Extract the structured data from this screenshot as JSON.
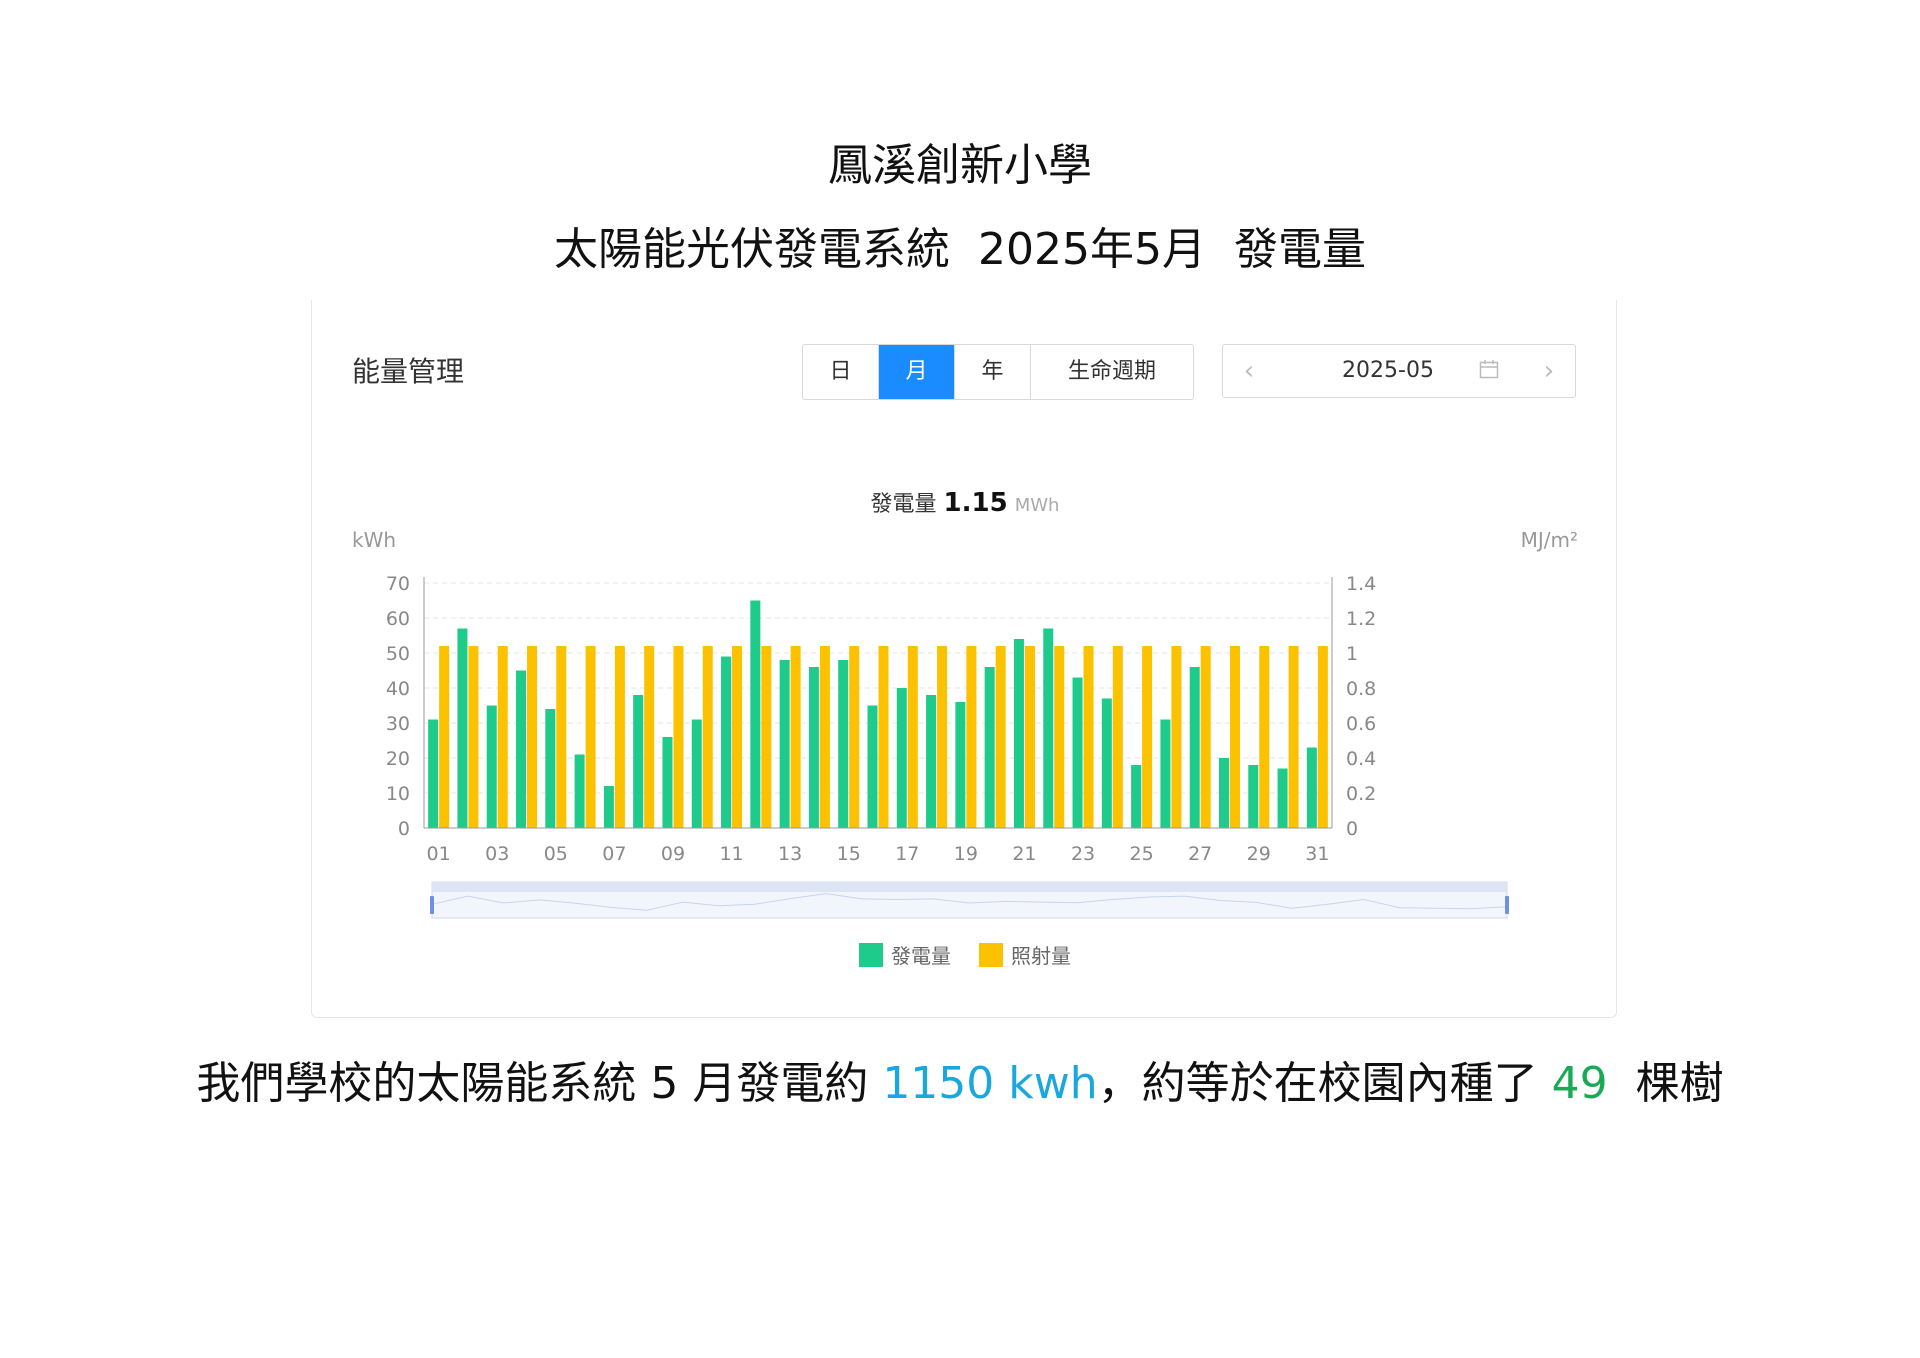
{
  "header": {
    "title": "鳳溪創新小學",
    "subtitle": "太陽能光伏發電系統  2025年5月  發電量"
  },
  "panel": {
    "title": "能量管理",
    "tabs": [
      {
        "label": "日",
        "active": false
      },
      {
        "label": "月",
        "active": true
      },
      {
        "label": "年",
        "active": false
      },
      {
        "label": "生命週期",
        "active": false
      }
    ],
    "date": "2025-05",
    "prev_icon": "‹",
    "next_icon": "›"
  },
  "summary": {
    "label": "發電量",
    "value": "1.15",
    "unit": "MWh"
  },
  "chart_data": {
    "type": "bar",
    "left_axis_unit": "kWh",
    "right_axis_unit": "MJ/m²",
    "ylim_left": [
      0,
      70
    ],
    "ylim_right": [
      0,
      1.4
    ],
    "left_ticks": [
      "0",
      "10",
      "20",
      "30",
      "40",
      "50",
      "60",
      "70"
    ],
    "right_ticks": [
      "0",
      "0.2",
      "0.4",
      "0.6",
      "0.8",
      "1",
      "1.2",
      "1.4"
    ],
    "categories": [
      "01",
      "02",
      "03",
      "04",
      "05",
      "06",
      "07",
      "08",
      "09",
      "10",
      "11",
      "12",
      "13",
      "14",
      "15",
      "16",
      "17",
      "18",
      "19",
      "20",
      "21",
      "22",
      "23",
      "24",
      "25",
      "26",
      "27",
      "28",
      "29",
      "30",
      "31"
    ],
    "x_tick_labels": [
      "01",
      "03",
      "05",
      "07",
      "09",
      "11",
      "13",
      "15",
      "17",
      "19",
      "21",
      "23",
      "25",
      "27",
      "29",
      "31"
    ],
    "grid": true,
    "legend_position": "bottom",
    "series": [
      {
        "name": "發電量",
        "axis": "left",
        "color": "#1fcb8a",
        "values": [
          31,
          57,
          35,
          45,
          34,
          21,
          12,
          38,
          26,
          31,
          49,
          65,
          48,
          46,
          48,
          35,
          40,
          38,
          36,
          46,
          54,
          57,
          43,
          37,
          18,
          31,
          46,
          20,
          18,
          17,
          23
        ]
      },
      {
        "name": "照射量",
        "axis": "right",
        "color": "#fcc200",
        "values": [
          1.04,
          1.04,
          1.04,
          1.04,
          1.04,
          1.04,
          1.04,
          1.04,
          1.04,
          1.04,
          1.04,
          1.04,
          1.04,
          1.04,
          1.04,
          1.04,
          1.04,
          1.04,
          1.04,
          1.04,
          1.04,
          1.04,
          1.04,
          1.04,
          1.04,
          1.04,
          1.04,
          1.04,
          1.04,
          1.04,
          1.04
        ]
      }
    ]
  },
  "footer": {
    "text_a": "我們學校的太陽能系統 5 月發電約 ",
    "highlight_energy": "1150 kwh",
    "text_b": "，約等於在校園內種了 ",
    "highlight_trees": "49",
    "text_c": "  棵樹"
  }
}
